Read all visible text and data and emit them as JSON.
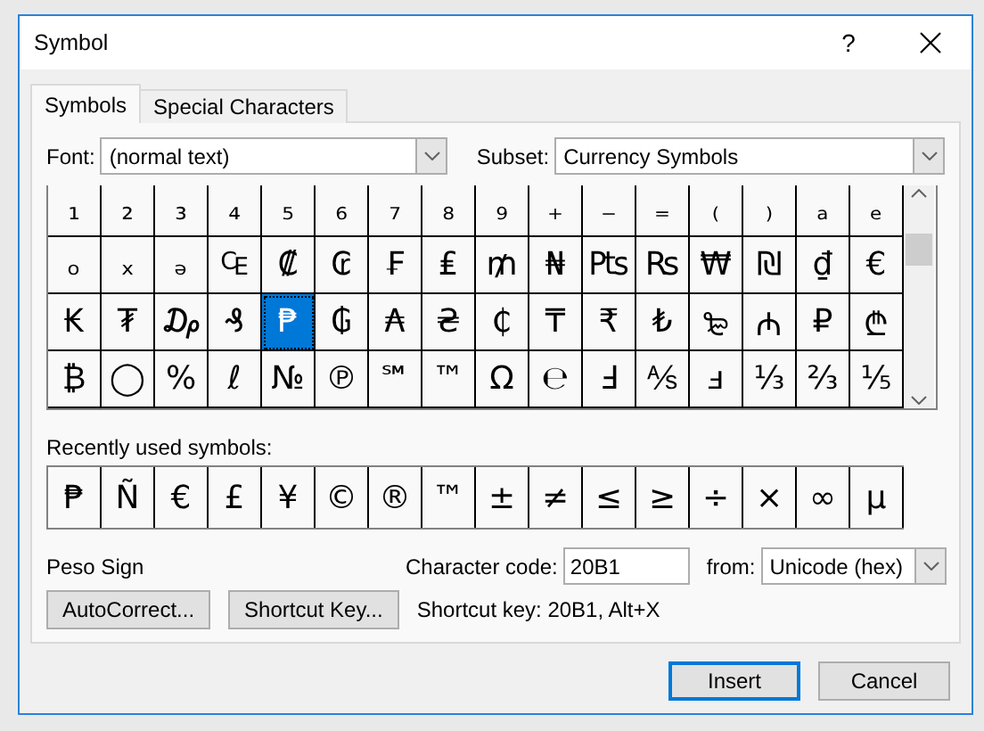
{
  "window": {
    "title": "Symbol",
    "help": "?"
  },
  "tabs": [
    {
      "label": "Symbols",
      "selected": true
    },
    {
      "label": "Special Characters",
      "selected": false
    }
  ],
  "font": {
    "label": "Font:",
    "value": "(normal text)"
  },
  "subset": {
    "label": "Subset:",
    "value": "Currency Symbols"
  },
  "grid": [
    [
      {
        "char": "₁",
        "selected": false
      },
      {
        "char": "₂",
        "selected": false
      },
      {
        "char": "₃",
        "selected": false
      },
      {
        "char": "₄",
        "selected": false
      },
      {
        "char": "₅",
        "selected": false
      },
      {
        "char": "₆",
        "selected": false
      },
      {
        "char": "₇",
        "selected": false
      },
      {
        "char": "₈",
        "selected": false
      },
      {
        "char": "₉",
        "selected": false
      },
      {
        "char": "₊",
        "selected": false
      },
      {
        "char": "₋",
        "selected": false
      },
      {
        "char": "₌",
        "selected": false
      },
      {
        "char": "₍",
        "selected": false
      },
      {
        "char": "₎",
        "selected": false
      },
      {
        "char": "ₐ",
        "selected": false
      },
      {
        "char": "ₑ",
        "selected": false
      }
    ],
    [
      {
        "char": "ₒ",
        "selected": false
      },
      {
        "char": "ₓ",
        "selected": false
      },
      {
        "char": "ₔ",
        "selected": false
      },
      {
        "char": "₠",
        "selected": false
      },
      {
        "char": "₡",
        "selected": false
      },
      {
        "char": "₢",
        "selected": false
      },
      {
        "char": "₣",
        "selected": false
      },
      {
        "char": "₤",
        "selected": false
      },
      {
        "char": "₥",
        "selected": false
      },
      {
        "char": "₦",
        "selected": false
      },
      {
        "char": "₧",
        "selected": false
      },
      {
        "char": "₨",
        "selected": false
      },
      {
        "char": "₩",
        "selected": false
      },
      {
        "char": "₪",
        "selected": false
      },
      {
        "char": "₫",
        "selected": false
      },
      {
        "char": "€",
        "selected": false
      }
    ],
    [
      {
        "char": "₭",
        "selected": false
      },
      {
        "char": "₮",
        "selected": false
      },
      {
        "char": "₯",
        "selected": false
      },
      {
        "char": "₰",
        "selected": false
      },
      {
        "char": "₱",
        "selected": true
      },
      {
        "char": "₲",
        "selected": false
      },
      {
        "char": "₳",
        "selected": false
      },
      {
        "char": "₴",
        "selected": false
      },
      {
        "char": "₵",
        "selected": false
      },
      {
        "char": "₸",
        "selected": false
      },
      {
        "char": "₹",
        "selected": false
      },
      {
        "char": "₺",
        "selected": false
      },
      {
        "char": "₻",
        "selected": false
      },
      {
        "char": "₼",
        "selected": false
      },
      {
        "char": "₽",
        "selected": false
      },
      {
        "char": "₾",
        "selected": false
      }
    ],
    [
      {
        "char": "₿",
        "selected": false
      },
      {
        "char": "◯",
        "selected": false
      },
      {
        "char": "%",
        "selected": false
      },
      {
        "char": "ℓ",
        "selected": false
      },
      {
        "char": "№",
        "selected": false
      },
      {
        "char": "℗",
        "selected": false
      },
      {
        "char": "℠",
        "selected": false
      },
      {
        "char": "™",
        "selected": false
      },
      {
        "char": "Ω",
        "selected": false
      },
      {
        "char": "℮",
        "selected": false
      },
      {
        "char": "Ⅎ",
        "selected": false
      },
      {
        "char": "⅍",
        "selected": false
      },
      {
        "char": "ⅎ",
        "selected": false
      },
      {
        "char": "⅓",
        "selected": false
      },
      {
        "char": "⅔",
        "selected": false
      },
      {
        "char": "⅕",
        "selected": false
      }
    ]
  ],
  "recent": {
    "label": "Recently used symbols:",
    "symbols": [
      "₱",
      "Ñ",
      "€",
      "£",
      "¥",
      "©",
      "®",
      "™",
      "±",
      "≠",
      "≤",
      "≥",
      "÷",
      "×",
      "∞",
      "µ"
    ]
  },
  "character_name": "Peso Sign",
  "character_code": {
    "label": "Character code:",
    "value": "20B1"
  },
  "from": {
    "label": "from:",
    "value": "Unicode (hex)"
  },
  "buttons": [
    "AutoCorrect...",
    "Shortcut Key..."
  ],
  "shortcut_text": "Shortcut key: 20B1, Alt+X",
  "footer_buttons": [
    {
      "label": "Insert",
      "default": true
    },
    {
      "label": "Cancel",
      "default": false
    }
  ]
}
